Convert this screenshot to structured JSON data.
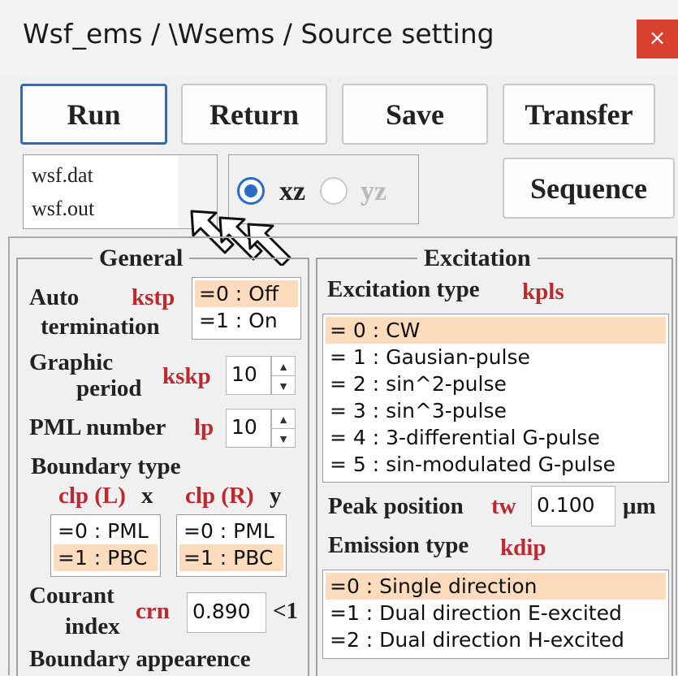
{
  "window": {
    "title": "Wsf_ems / \\Wsems / Source setting",
    "close_label": "×"
  },
  "buttons": {
    "run": "Run",
    "return": "Return",
    "save": "Save",
    "transfer": "Transfer",
    "sequence": "Sequence"
  },
  "files": [
    "wsf.dat",
    "wsf.out"
  ],
  "plane": {
    "xz": "xz",
    "yz": "yz",
    "selected": "xz"
  },
  "general": {
    "title": "General",
    "auto_termination": {
      "label_line1": "Auto",
      "label_line2": "termination",
      "var": "kstp",
      "options": [
        "=0 : Off",
        "=1 : On"
      ],
      "selected_index": 0
    },
    "graphic_period": {
      "label_line1": "Graphic",
      "label_line2": "period",
      "var": "kskp",
      "value": "10"
    },
    "pml_number": {
      "label": "PML number",
      "var": "lp",
      "value": "10"
    },
    "boundary_type": {
      "label": "Boundary type",
      "left": {
        "var": "clp (L)",
        "axis": "x",
        "options": [
          "=0 : PML",
          "=1 : PBC"
        ],
        "selected_index": 1
      },
      "right": {
        "var": "clp (R)",
        "axis": "y",
        "options": [
          "=0 : PML",
          "=1 : PBC"
        ],
        "selected_index": 1
      }
    },
    "courant": {
      "label_line1": "Courant",
      "label_line2": "index",
      "var": "crn",
      "value": "0.890",
      "suffix": "<1"
    },
    "boundary_appearance": {
      "label": "Boundary appearence"
    }
  },
  "excitation": {
    "title": "Excitation",
    "type_label": "Excitation type",
    "type_var": "kpls",
    "type_options": [
      "= 0 : CW",
      "= 1 : Gausian-pulse",
      "= 2 : sin^2-pulse",
      "= 3 : sin^3-pulse",
      "= 4 : 3-differential G-pulse",
      "= 5 : sin-modulated G-pulse"
    ],
    "type_selected_index": 0,
    "peak": {
      "label": "Peak position",
      "var": "tw",
      "value": "0.100",
      "unit": "μm"
    },
    "emission_label": "Emission type",
    "emission_var": "kdip",
    "emission_options": [
      "=0 : Single direction",
      "=1 : Dual direction E-excited",
      "=2 : Dual direction H-excited"
    ],
    "emission_selected_index": 0
  },
  "colors": {
    "accent": "#2a6bc6",
    "close": "#d8412f",
    "selection": "#fcdcbd",
    "variable": "#c0282d"
  }
}
